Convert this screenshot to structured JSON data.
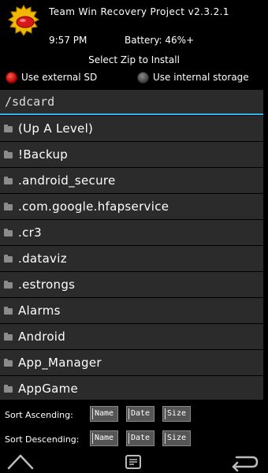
{
  "header": {
    "title": "Team Win Recovery Project  v2.3.2.1",
    "time": "9:57 PM",
    "battery": "Battery: 46%+"
  },
  "section_title": "Select Zip to Install",
  "storage": {
    "external_label": "Use external SD",
    "internal_label": "Use internal storage",
    "selected": "external"
  },
  "path": "/sdcard",
  "files": [
    "(Up A Level)",
    "!Backup",
    ".android_secure",
    ".com.google.hfapservice",
    ".cr3",
    ".dataviz",
    ".estrongs",
    "Alarms",
    "Android",
    "App_Manager",
    "AppGame"
  ],
  "sort": {
    "ascending_label": "Sort Ascending:",
    "descending_label": "Sort Descending:",
    "name_label": "Name",
    "date_label": "Date",
    "size_label": "Size"
  },
  "icons": {
    "logo": "twrp-logo-icon",
    "folder": "folder-icon",
    "home": "home-icon",
    "console": "console-icon",
    "back": "back-icon"
  },
  "colors": {
    "accent": "#33b5e5",
    "row_background": "#2b2b2b",
    "radio_selected": "#d40000"
  }
}
